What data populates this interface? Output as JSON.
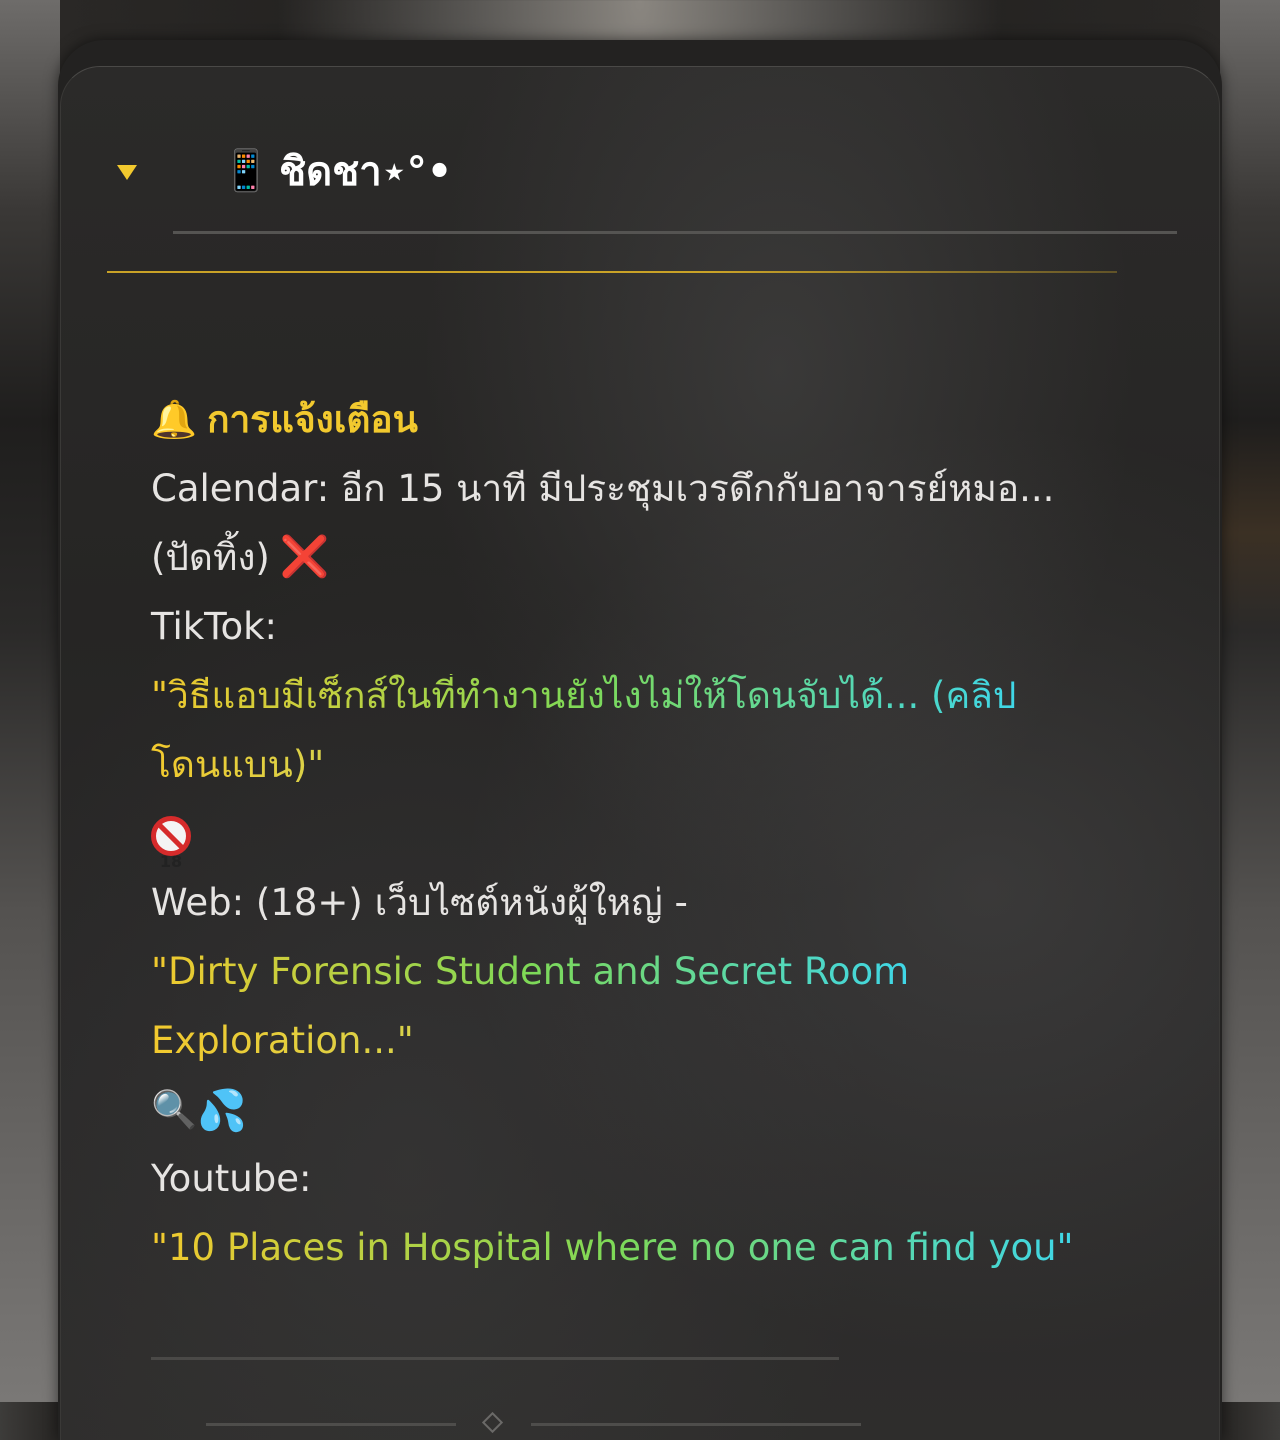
{
  "header": {
    "collapse_icon": "triangle-down-icon",
    "phone_emoji": "📱",
    "title": "ชิดชา⋆°•"
  },
  "notifications": {
    "heading_emoji": "🔔",
    "heading": "การแจ้งเตือน",
    "calendar_line1": "Calendar: อีก 15 นาที มีประชุมเวรดึกกับอาจารย์หมอ...",
    "calendar_line2": "(ปัดทิ้ง)",
    "dismiss_emoji": "❌",
    "tiktok_label": "TikTok:",
    "tiktok_text_line1": "\"วิธีแอบมีเซ็กส์ในที่ทำงานยังไงไม่ให้โดนจับได้... (คลิป",
    "tiktok_text_line2": "โดนแบน)\"",
    "under18_badge": "18",
    "web_label": "Web: (18+) เว็บไซต์หนังผู้ใหญ่ -",
    "web_text_line1": "\"Dirty Forensic Student and Secret Room",
    "web_text_line2": "Exploration...\"",
    "search_emoji": "🔍",
    "drops_emoji": "💦",
    "youtube_label": "Youtube:",
    "youtube_text": "\"10 Places in Hospital where no one can find you\""
  },
  "colors": {
    "accent": "#f2c92e",
    "gradient_mid": "#7ed957",
    "gradient_end": "#3fd7e8",
    "text": "#e6e4e2",
    "card_bg": "#262524"
  }
}
